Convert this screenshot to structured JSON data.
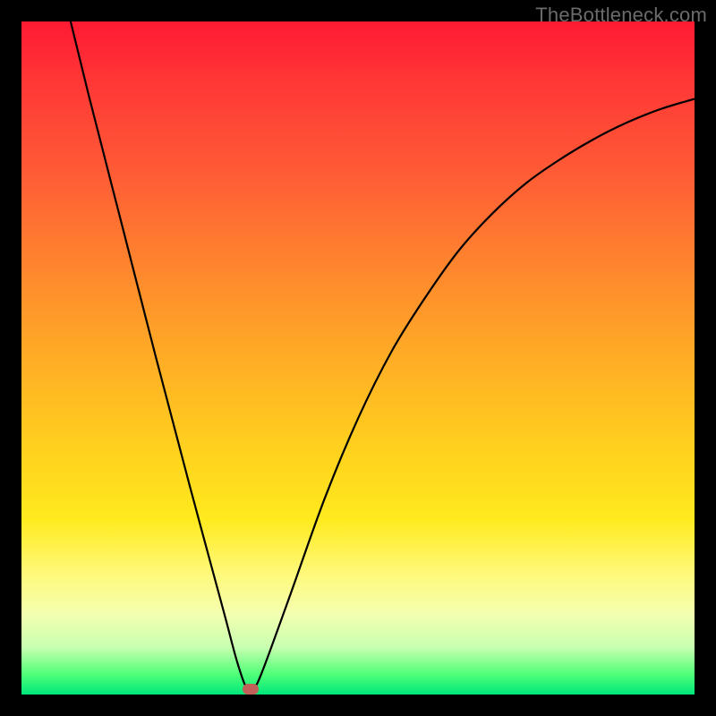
{
  "watermark": "TheBottleneck.com",
  "colors": {
    "curve_stroke": "#000000",
    "dot_fill": "#c06058",
    "frame_bg": "#000000"
  },
  "chart_data": {
    "type": "line",
    "title": "",
    "xlabel": "",
    "ylabel": "",
    "xlim": [
      0,
      100
    ],
    "ylim": [
      0,
      100
    ],
    "grid": false,
    "legend": false,
    "series": [
      {
        "name": "curve",
        "x": [
          7.3,
          10,
          15,
          20,
          25,
          30,
          32,
          33.5,
          34.5,
          36,
          40,
          45,
          50,
          55,
          60,
          65,
          70,
          75,
          80,
          85,
          90,
          95,
          100
        ],
        "y": [
          100,
          89,
          69.5,
          50,
          31,
          12.5,
          5,
          0.8,
          0.8,
          4,
          15,
          29,
          41,
          51,
          59,
          66,
          71.5,
          76,
          79.5,
          82.5,
          85,
          87,
          88.5
        ]
      }
    ],
    "minimum_marker": {
      "x": 34,
      "y": 0.8
    }
  }
}
